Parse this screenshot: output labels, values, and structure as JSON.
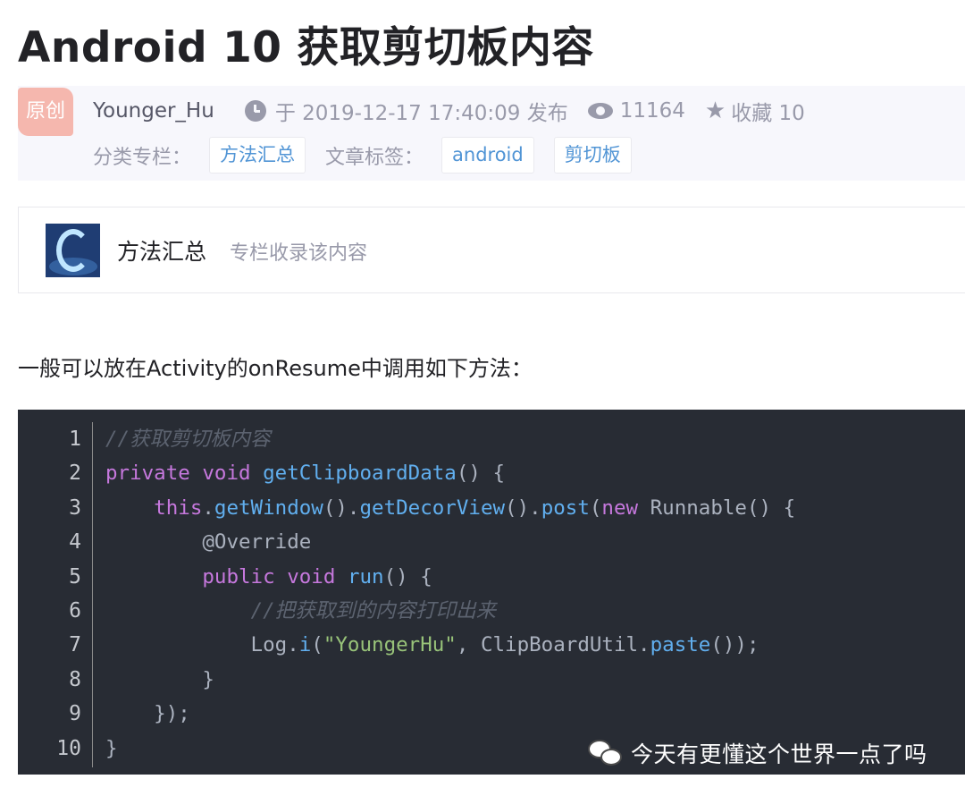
{
  "article": {
    "title": "Android 10 获取剪切板内容",
    "badge": "原创",
    "author": "Younger_Hu",
    "published": "于 2019-12-17 17:40:09 发布",
    "views": "11164",
    "favorites": "收藏 10",
    "category_label": "分类专栏：",
    "category_tag": "方法汇总",
    "tags_label": "文章标签：",
    "tags": [
      "android",
      "剪切板"
    ]
  },
  "column": {
    "name": "方法汇总",
    "desc": "专栏收录该内容"
  },
  "paragraph": "一般可以放在Activity的onResume中调用如下方法：",
  "code": {
    "line_numbers": [
      "1",
      "2",
      "3",
      "4",
      "5",
      "6",
      "7",
      "8",
      "9",
      "10"
    ],
    "lines": [
      [
        {
          "t": "//获取剪切板内容",
          "c": "cm"
        }
      ],
      [
        {
          "t": "private",
          "c": "kw"
        },
        {
          "t": " ",
          "c": "pl"
        },
        {
          "t": "void",
          "c": "kw"
        },
        {
          "t": " ",
          "c": "pl"
        },
        {
          "t": "getClipboardData",
          "c": "fn"
        },
        {
          "t": "() {",
          "c": "pl"
        }
      ],
      [
        {
          "t": "    ",
          "c": "pl"
        },
        {
          "t": "this",
          "c": "kw"
        },
        {
          "t": ".",
          "c": "pl"
        },
        {
          "t": "getWindow",
          "c": "fn"
        },
        {
          "t": "().",
          "c": "pl"
        },
        {
          "t": "getDecorView",
          "c": "fn"
        },
        {
          "t": "().",
          "c": "pl"
        },
        {
          "t": "post",
          "c": "fn"
        },
        {
          "t": "(",
          "c": "pl"
        },
        {
          "t": "new",
          "c": "kw"
        },
        {
          "t": " Runnable() {",
          "c": "pl"
        }
      ],
      [
        {
          "t": "        @Override",
          "c": "pl"
        }
      ],
      [
        {
          "t": "        ",
          "c": "pl"
        },
        {
          "t": "public",
          "c": "kw"
        },
        {
          "t": " ",
          "c": "pl"
        },
        {
          "t": "void",
          "c": "kw"
        },
        {
          "t": " ",
          "c": "pl"
        },
        {
          "t": "run",
          "c": "fn"
        },
        {
          "t": "() {",
          "c": "pl"
        }
      ],
      [
        {
          "t": "            ",
          "c": "pl"
        },
        {
          "t": "//把获取到的内容打印出来",
          "c": "cm"
        }
      ],
      [
        {
          "t": "            Log.",
          "c": "pl"
        },
        {
          "t": "i",
          "c": "fn"
        },
        {
          "t": "(",
          "c": "pl"
        },
        {
          "t": "\"YoungerHu\"",
          "c": "st"
        },
        {
          "t": ", ClipBoardUtil.",
          "c": "pl"
        },
        {
          "t": "paste",
          "c": "fn"
        },
        {
          "t": "());",
          "c": "pl"
        }
      ],
      [
        {
          "t": "        }",
          "c": "pl"
        }
      ],
      [
        {
          "t": "    });",
          "c": "pl"
        }
      ],
      [
        {
          "t": "}",
          "c": "pl"
        }
      ]
    ]
  },
  "watermark": {
    "text": "今天有更懂这个世界一点了吗",
    "icon": "wechat-icon"
  },
  "colors": {
    "badge": "#f5b7ae",
    "tag_text": "#5094d5",
    "code_bg": "#282c34",
    "keyword": "#c678dd",
    "function": "#61afef",
    "string": "#98c379",
    "comment": "#5c6370"
  }
}
